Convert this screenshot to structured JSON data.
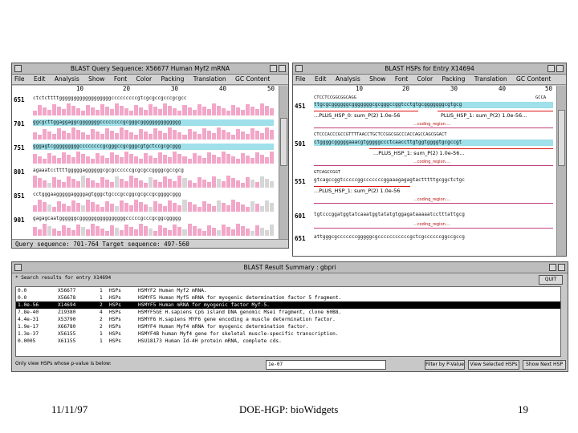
{
  "query_window": {
    "title": "BLAST Query Sequence: X56677 Human Myf2 mRNA",
    "menu": [
      "File",
      "Edit",
      "Analysis",
      "Show",
      "Font",
      "Color",
      "Packing",
      "Translation",
      "GC Content"
    ],
    "ruler": [
      "10",
      "20",
      "30",
      "40",
      "50"
    ],
    "rows": [
      {
        "label": "651",
        "seq": "ctctcttttggggggggggggggggggcccccccccgtcgcgccgcccgcgcc"
      },
      {
        "label": "701",
        "seq": "ggcgcttggaggaggcgggggggccccccccgcgggcgggggggggggggg"
      },
      {
        "label": "751",
        "seq": "gggagtcgggggggggccccccccgcgggccgcgggcgtgctccgcgcggg"
      },
      {
        "label": "801",
        "seq": "agaaatccttttgggggaggggggcgcgccccccgcgcgccggggcgccgcg"
      },
      {
        "label": "851",
        "seq": "cctgggaagggggaggggagtgggctgcccgccggcgcgccgcggggcggg"
      },
      {
        "label": "901",
        "seq": "gagagcaatggggggcggggggggggggggggcccccgcccgcggcggggg"
      }
    ],
    "status": "Query sequence: 701-764 Target sequence: 497-560"
  },
  "hsp_window": {
    "title": "BLAST HSPs for Entry X14694",
    "menu": [
      "File",
      "Edit",
      "Analysis",
      "Show",
      "Font",
      "Color",
      "Packing",
      "Translation",
      "GC Content"
    ],
    "ruler": [
      "10",
      "20",
      "30",
      "40",
      "50"
    ],
    "rows": [
      {
        "label": "451",
        "seq": "ttgcgcggggggcgggggggcgcgggccggtcctgtgcgggggggcgtgcg",
        "top": "CTCCTCCGGCGGCAGG",
        "right_top": "GCCA"
      },
      {
        "label": "501",
        "seq": "ctggggcgggggaaacgtgggggccctcaaccttgtggtggggtgcgccgt",
        "top": "CTCCCACCCGCCGTTTTAACCTGCTCCGGCGGCCCACCAGCCAGCGGACT"
      },
      {
        "label": "551",
        "seq": "gtcagccggtcccccggcccccccggaaagagagtactttttgcggctctgc",
        "top": "GTCAGCCGGT"
      },
      {
        "label": "601",
        "seq": "tgtcccggatggtatcaaatggtatatgtggagataaaaatcctttattgcg"
      },
      {
        "label": "651",
        "seq": "attgggcgcccccccgggggcgcccccccccccgctcgccccccggccgccg"
      }
    ],
    "hsps": [
      "...PLUS_HSP_0: sum_P(2) 1.0e-56",
      "PLUS_HSP_1: sum_P(2) 1.0e-56...",
      "...PLUS_HSP_1: sum_P(2) 1.0e-56...",
      "...PLUS_HSP_1: sum_P(2) 1.0e-56",
      "...PLUS_HSP_1: sum_P(2) 1.0e-56"
    ],
    "coding_note": "...coding_region...."
  },
  "summary_window": {
    "title": "BLAST Result Summary : gbpri",
    "header_left": "* Search results for entry X14694",
    "header_right": "QUIT",
    "rows": [
      {
        "score": "0.0",
        "acc": "X56677",
        "n": "1",
        "hsps": "HSPs",
        "desc": "HSMYF2 Human Myf2 mRNA."
      },
      {
        "score": "0.0",
        "acc": "X56678",
        "n": "1",
        "hsps": "HSPs",
        "desc": "HSMYF5 Human Myf5 mRNA for myogenic determination factor 5 fragment."
      },
      {
        "score": "1.0e-56",
        "acc": "X14694",
        "n": "2",
        "hsps": "HSPs",
        "desc": "HSMYF5 Human mRNA for myogenic factor Myf-5."
      },
      {
        "score": "7.8e-40",
        "acc": "Z19380",
        "n": "4",
        "hsps": "HSPs",
        "desc": "HSMYF5GE H.sapiens CpG island DNA genomic Mse1 fragment, clone 60B8."
      },
      {
        "score": "4.4e-31",
        "acc": "X53790",
        "n": "2",
        "hsps": "HSPs",
        "desc": "HSMYF6 H.sapiens MYF6 gene encoding a muscle determination factor."
      },
      {
        "score": "1.9e-17",
        "acc": "X66780",
        "n": "2",
        "hsps": "HSPs",
        "desc": "HSMYF4 Human Myf4 mRNA for myogenic determination factor."
      },
      {
        "score": "1.3e-37",
        "acc": "X56155",
        "n": "1",
        "hsps": "HSPs",
        "desc": "HSMYF4B human Myf4 gene for skeletal muscle-specific transcription."
      },
      {
        "score": "0.0005",
        "acc": "X61155",
        "n": "1",
        "hsps": "HSPs",
        "desc": "HSU18173 Human Id-4H protein mRNA, complete cds."
      }
    ],
    "selected_index": 2,
    "footer_label": "Only view HSPs whose p-value is below:",
    "footer_value": "1e-07",
    "buttons": [
      "Filter by P-Value",
      "View Selected HSPs",
      "Show Next HSP"
    ]
  },
  "slide_footer": {
    "date": "11/11/97",
    "center": "DOE-HGP: bioWidgets",
    "page": "19"
  },
  "colors": {
    "window_gray": "#c8c8c8",
    "pink_hist": "#f2a6c8",
    "cyan_hl": "#9fe0ea",
    "selection": "#000000",
    "hsp_line": "#e01010"
  }
}
